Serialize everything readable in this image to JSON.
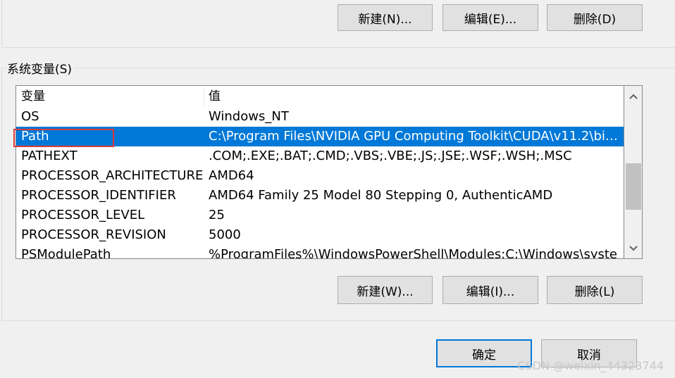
{
  "user_vars_buttons": {
    "new": "新建(N)...",
    "edit": "编辑(E)...",
    "delete": "删除(D)"
  },
  "system_vars": {
    "legend": "系统变量(S)",
    "columns": {
      "variable": "变量",
      "value": "值"
    },
    "rows": [
      {
        "name": "OS",
        "value": "Windows_NT"
      },
      {
        "name": "Path",
        "value": "C:\\Program Files\\NVIDIA GPU Computing Toolkit\\CUDA\\v11.2\\bin...",
        "selected": true
      },
      {
        "name": "PATHEXT",
        "value": ".COM;.EXE;.BAT;.CMD;.VBS;.VBE;.JS;.JSE;.WSF;.WSH;.MSC"
      },
      {
        "name": "PROCESSOR_ARCHITECTURE",
        "value": "AMD64"
      },
      {
        "name": "PROCESSOR_IDENTIFIER",
        "value": "AMD64 Family 25 Model 80 Stepping 0, AuthenticAMD"
      },
      {
        "name": "PROCESSOR_LEVEL",
        "value": "25"
      },
      {
        "name": "PROCESSOR_REVISION",
        "value": "5000"
      },
      {
        "name": "PSModulePath",
        "value": "%ProgramFiles%\\WindowsPowerShell\\Modules;C:\\Windows\\syste"
      }
    ],
    "buttons": {
      "new": "新建(W)...",
      "edit": "编辑(I)...",
      "delete": "删除(L)"
    }
  },
  "dialog_buttons": {
    "ok": "确定",
    "cancel": "取消"
  },
  "watermark": "CSDN @weixin_44323744",
  "colors": {
    "selection": "#0078d7",
    "highlight_box": "#e03a3a"
  },
  "icons": {
    "scroll_up": "chevron-up-icon",
    "scroll_down": "chevron-down-icon"
  }
}
